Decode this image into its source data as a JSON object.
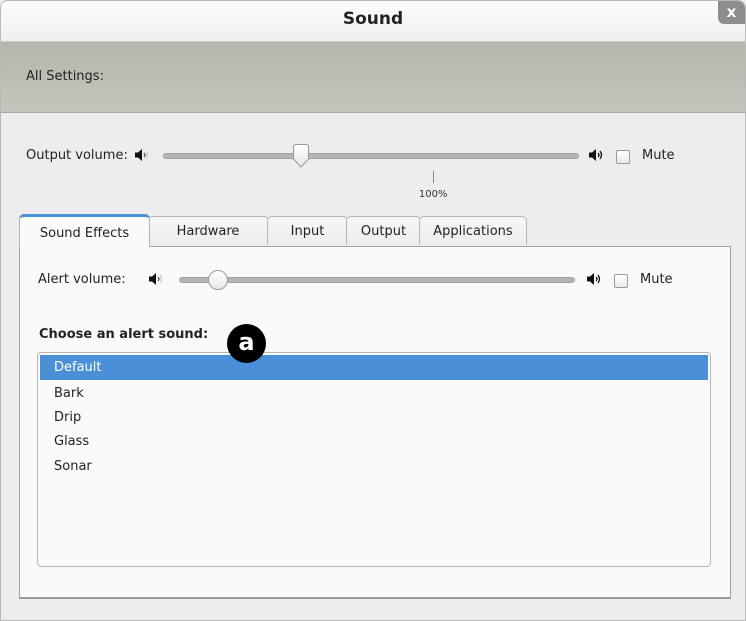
{
  "window": {
    "title": "Sound",
    "close_label": "x"
  },
  "header": {
    "all_settings_label": "All Settings:"
  },
  "output": {
    "label": "Output volume:",
    "volume_percent": 51,
    "mark_label": "100%",
    "mark_value_percent": 100,
    "mute_label": "Mute",
    "muted": false,
    "low_icon": "speaker-low-icon",
    "high_icon": "speaker-high-icon"
  },
  "tabs": [
    {
      "label": "Sound Effects",
      "active": true
    },
    {
      "label": "Hardware",
      "active": false
    },
    {
      "label": "Input",
      "active": false
    },
    {
      "label": "Output",
      "active": false
    },
    {
      "label": "Applications",
      "active": false
    }
  ],
  "sound_effects": {
    "alert_volume_label": "Alert volume:",
    "alert_volume_percent": 10,
    "mute_label": "Mute",
    "muted": false,
    "choose_label": "Choose an alert sound:",
    "sounds": [
      "Default",
      "Bark",
      "Drip",
      "Glass",
      "Sonar"
    ],
    "selected": "Default"
  },
  "annotation": {
    "badge_label": "a"
  },
  "colors": {
    "accent": "#4a8fd8",
    "header_band": "#b8b7ae"
  }
}
